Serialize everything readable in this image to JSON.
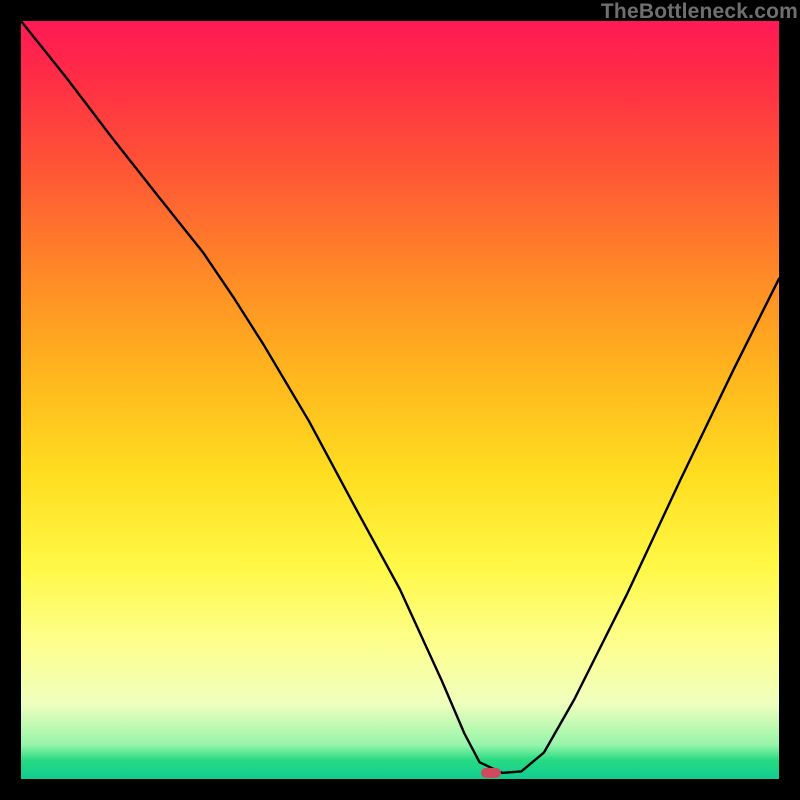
{
  "watermark": "TheBottleneck.com",
  "chart_data": {
    "type": "line",
    "title": "",
    "xlabel": "",
    "ylabel": "",
    "xlim": [
      0,
      1
    ],
    "ylim": [
      0,
      1
    ],
    "series": [
      {
        "name": "bottleneck-curve",
        "x": [
          0.0,
          0.06,
          0.12,
          0.18,
          0.24,
          0.28,
          0.32,
          0.38,
          0.44,
          0.5,
          0.555,
          0.585,
          0.605,
          0.635,
          0.66,
          0.69,
          0.73,
          0.8,
          0.87,
          0.94,
          1.0
        ],
        "values": [
          1.0,
          0.925,
          0.846,
          0.77,
          0.695,
          0.636,
          0.573,
          0.472,
          0.36,
          0.25,
          0.13,
          0.06,
          0.022,
          0.008,
          0.01,
          0.035,
          0.105,
          0.245,
          0.395,
          0.54,
          0.66
        ]
      }
    ],
    "marker": {
      "x": 0.62,
      "y": 0.008
    },
    "colors": {
      "curve": "#000000",
      "marker": "#cf4a5e",
      "gradient_top": "#ff1a56",
      "gradient_bottom": "#0fcd91"
    }
  }
}
